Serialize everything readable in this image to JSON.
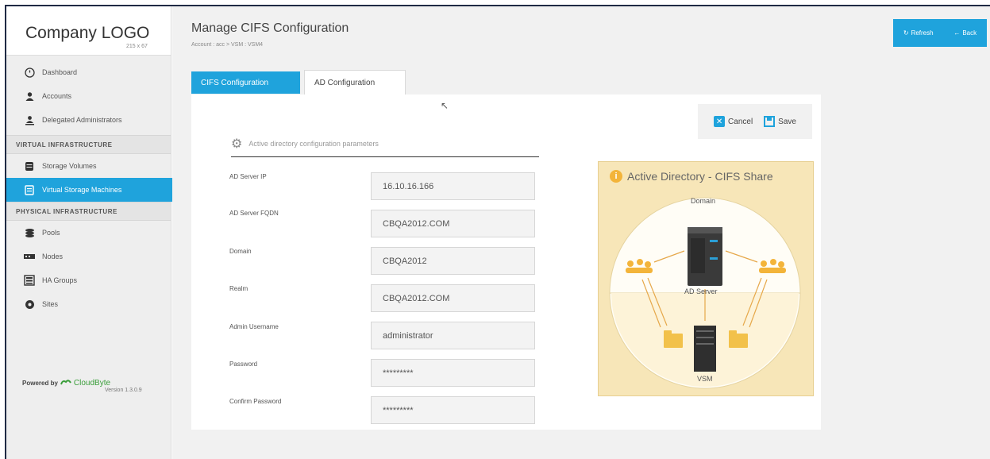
{
  "brand": {
    "logo_text": "Company LOGO",
    "logo_size": "215 x 67"
  },
  "sidebar": {
    "items_top": [
      {
        "label": "Dashboard",
        "icon": "dashboard-icon"
      },
      {
        "label": "Accounts",
        "icon": "user-icon"
      },
      {
        "label": "Delegated Administrators",
        "icon": "admin-icon"
      }
    ],
    "section_virtual": "VIRTUAL INFRASTRUCTURE",
    "items_virtual": [
      {
        "label": "Storage Volumes",
        "icon": "storage-icon"
      },
      {
        "label": "Virtual Storage Machines",
        "icon": "server-icon",
        "active": true
      }
    ],
    "section_physical": "PHYSICAL INFRASTRUCTURE",
    "items_physical": [
      {
        "label": "Pools",
        "icon": "pools-icon"
      },
      {
        "label": "Nodes",
        "icon": "nodes-icon"
      },
      {
        "label": "HA Groups",
        "icon": "ha-groups-icon"
      },
      {
        "label": "Sites",
        "icon": "sites-icon"
      }
    ],
    "powered_by": "Powered by",
    "powered_brand": "CloudByte",
    "version": "Version 1.3.0.9"
  },
  "header": {
    "title": "Manage CIFS Configuration",
    "breadcrumb": "Account : acc  >  VSM : VSM4",
    "refresh_label": "Refresh",
    "back_label": "Back"
  },
  "tabs": [
    {
      "label": "CIFS Configuration",
      "active": false
    },
    {
      "label": "AD Configuration",
      "active": true
    }
  ],
  "actions": {
    "cancel_label": "Cancel",
    "save_label": "Save"
  },
  "form": {
    "section_title": "Active directory configuration parameters",
    "fields": [
      {
        "label": "AD Server IP",
        "value": "16.10.16.166"
      },
      {
        "label": "AD Server FQDN",
        "value": "CBQA2012.COM"
      },
      {
        "label": "Domain",
        "value": "CBQA2012"
      },
      {
        "label": "Realm",
        "value": "CBQA2012.COM"
      },
      {
        "label": "Admin Username",
        "value": "administrator"
      },
      {
        "label": "Password",
        "value": "*********"
      },
      {
        "label": "Confirm Password",
        "value": "*********"
      }
    ]
  },
  "diagram": {
    "title": "Active Directory - CIFS Share",
    "domain_label": "Domain",
    "server_label": "AD Server",
    "vsm_label": "VSM"
  },
  "colors": {
    "accent": "#1fa3dc",
    "diagram_bg": "#f7e6b8",
    "sidebar_bg": "#eeeeee"
  }
}
